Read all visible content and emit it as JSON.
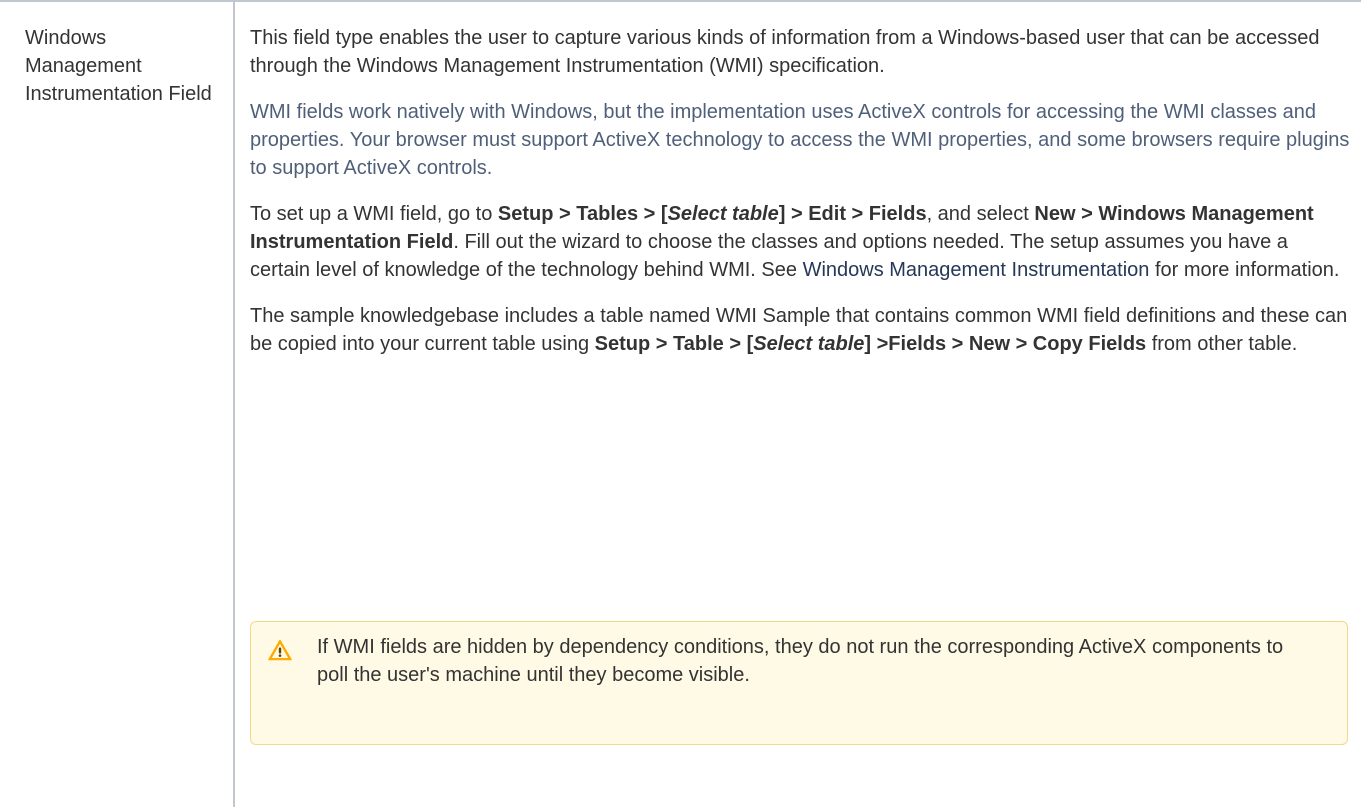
{
  "row": {
    "field_name": "Windows Management Instrumentation Field"
  },
  "description": {
    "p1": "This field type enables the user to capture various kinds of information from a Windows-based user that can be accessed through the Windows Management Instrumentation (WMI) specification.",
    "p2": "WMI fields work natively with Windows, but the implementation uses ActiveX controls for accessing the WMI classes and properties. Your browser must support ActiveX technology to access the WMI properties, and some browsers require plugins to support ActiveX controls.",
    "p3": {
      "t1": "To set up a WMI field, go to ",
      "path1a": "Setup > Tables > [",
      "path1_italic": "Select table",
      "path1b": "] > Edit > Fields",
      "t2": ", and select ",
      "path2": "New > Windows Management Instrumentation Field",
      "t3": ". Fill out the wizard to choose the classes and options needed. The setup assumes you have a certain level of knowledge of the technology behind WMI. See ",
      "link": "Windows Management Instrumentation",
      "t4": " for more information."
    },
    "p4": {
      "t1": "The sample knowledgebase includes a table named WMI Sample that contains common WMI field definitions and these can be copied into your current table using ",
      "path_a": "Setup > Table > [",
      "path_italic": "Select table",
      "path_b": "] >Fields > New > Copy Fields",
      "t2": " from other table."
    }
  },
  "note": {
    "icon": "warning-icon",
    "text": "If WMI fields are hidden by dependency conditions, they do not run the corresponding ActiveX components to poll the user's machine until they become visible."
  },
  "colors": {
    "border": "#c1c7d0",
    "note_bg": "#fffae6",
    "warning": "#ffab00",
    "link": "#253858"
  }
}
